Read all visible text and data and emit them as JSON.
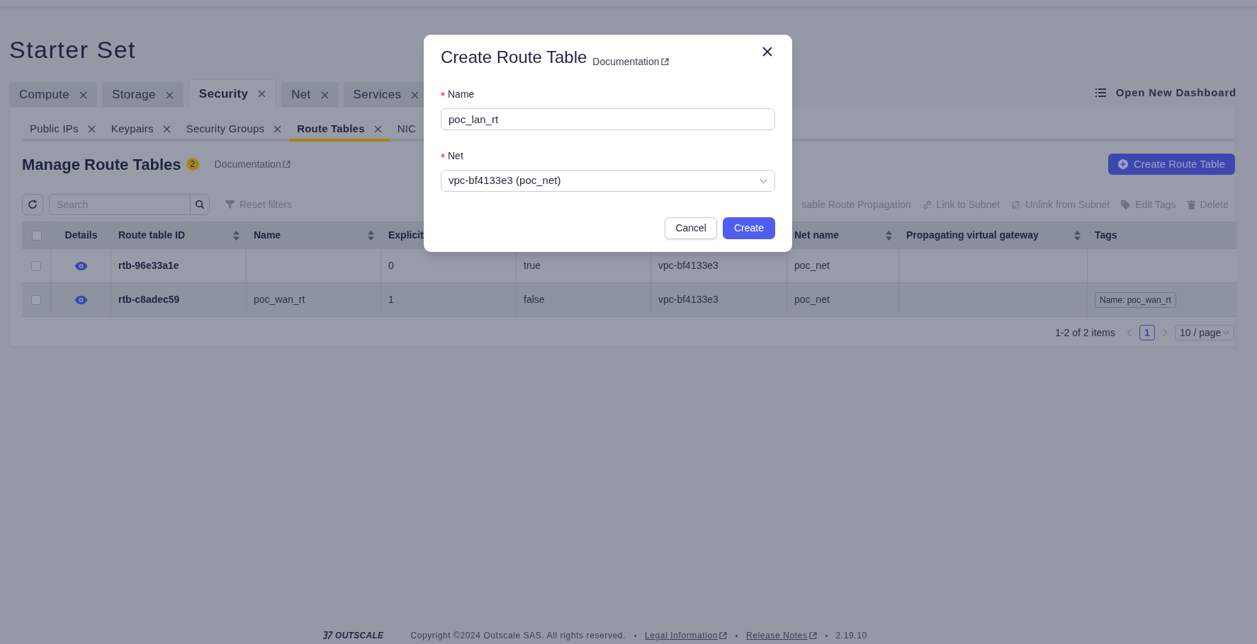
{
  "page_title": "Starter Set",
  "tabs": [
    {
      "label": "Compute",
      "selected": false
    },
    {
      "label": "Storage",
      "selected": false
    },
    {
      "label": "Security",
      "selected": true
    },
    {
      "label": "Net",
      "selected": false
    },
    {
      "label": "Services",
      "selected": false
    }
  ],
  "header_action": {
    "label": "Open New Dashboard"
  },
  "subtabs": [
    {
      "label": "Public IPs",
      "selected": false
    },
    {
      "label": "Keypairs",
      "selected": false
    },
    {
      "label": "Security Groups",
      "selected": false
    },
    {
      "label": "Route Tables",
      "selected": true
    },
    {
      "label": "NIC",
      "selected": false
    }
  ],
  "section": {
    "title": "Manage Route Tables",
    "count": "2",
    "doc_link": "Documentation",
    "create_button": "Create Route Table"
  },
  "toolbar": {
    "search": {
      "placeholder": "Search"
    },
    "reset_filters": "Reset filters",
    "actions": [
      {
        "kind": "propagation",
        "label": "sable Route Propagation"
      },
      {
        "kind": "link",
        "label": "Link to Subnet"
      },
      {
        "kind": "unlink",
        "label": "Unlink from Subnet"
      },
      {
        "kind": "tag",
        "label": "Edit Tags"
      },
      {
        "kind": "delete",
        "label": "Delete"
      }
    ]
  },
  "table": {
    "all_checked": false,
    "columns": {
      "details": {
        "label": "Details",
        "sortable": false
      },
      "route_table_id": {
        "label": "Route table ID",
        "sortable": true
      },
      "name": {
        "label": "Name",
        "sortable": true
      },
      "explicit": {
        "label": "Explicit"
      },
      "net_name": {
        "label": "Net name",
        "sortable": true
      },
      "propagating_virtual_gateway": {
        "label": "Propagating virtual gateway",
        "sortable": true
      },
      "tags": {
        "label": "Tags",
        "sortable": false
      }
    },
    "rows": [
      {
        "checked": false,
        "route_table_id": "rtb-96e33a1e",
        "explicit": "0",
        "column_5": "true",
        "column_6": "vpc-bf4133e3",
        "net_name": "poc_net"
      },
      {
        "checked": false,
        "route_table_id": "rtb-c8adec59",
        "name": "poc_wan_rt",
        "explicit": "1",
        "column_5": "false",
        "column_6": "vpc-bf4133e3",
        "net_name": "poc_net",
        "tags": [
          "Name: poc_wan_rt"
        ]
      }
    ]
  },
  "pagination": {
    "summary": "1-2 of 2 items",
    "pages": [
      {
        "label": "1",
        "selected": true
      }
    ],
    "page_size": "10 / page"
  },
  "footer": {
    "logo": "OUTSCALE",
    "copyright": "Copyright ©2024 Outscale SAS. All rights reserved.",
    "links": [
      "Legal Information",
      "Release Notes"
    ],
    "version": "2.19.10"
  },
  "modal": {
    "title": "Create Route Table",
    "doc_link": "Documentation",
    "fields": [
      {
        "kind": "text",
        "label": "Name",
        "required": true,
        "value": "poc_lan_rt"
      },
      {
        "kind": "select",
        "label": "Net",
        "required": true,
        "value": "vpc-bf4133e3 (poc_net)"
      }
    ],
    "buttons": [
      {
        "kind": "secondary",
        "label": "Cancel"
      },
      {
        "kind": "primary",
        "label": "Create"
      }
    ]
  }
}
